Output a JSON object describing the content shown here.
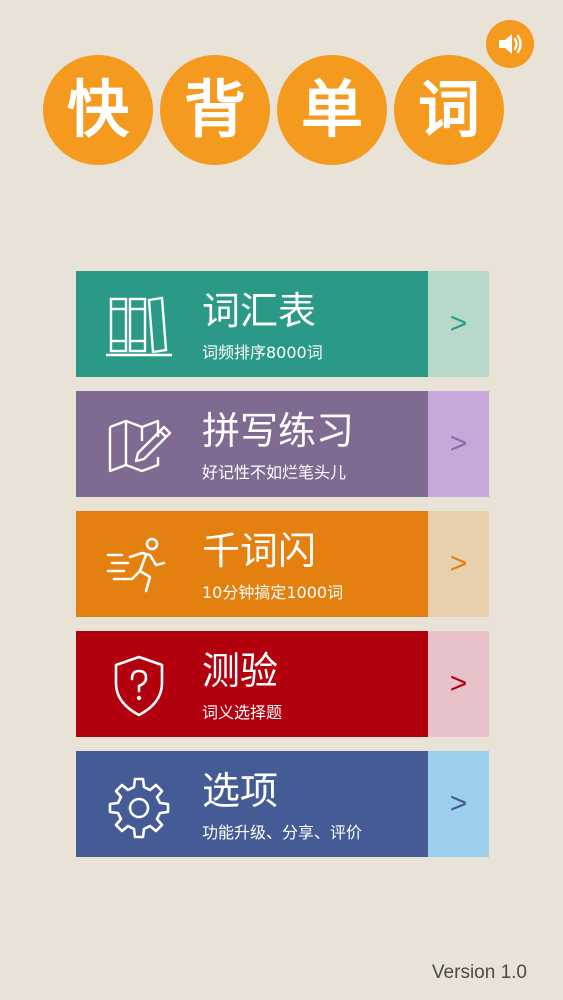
{
  "app": {
    "title_chars": [
      "快",
      "背",
      "单",
      "词"
    ],
    "sound_icon": "speaker-icon"
  },
  "menu": [
    {
      "title": "词汇表",
      "subtitle": "词频排序8000词",
      "arrow": ">",
      "icon": "books-icon",
      "main_color": "#2a9a87",
      "side_color": "#b7d9c9",
      "arrow_color": "#2a9a87"
    },
    {
      "title": "拼写练习",
      "subtitle": "好记性不如烂笔头儿",
      "arrow": ">",
      "icon": "map-pencil-icon",
      "main_color": "#7f6b91",
      "side_color": "#c6a8db",
      "arrow_color": "#8b6fa3"
    },
    {
      "title": "千词闪",
      "subtitle": "10分钟搞定1000词",
      "arrow": ">",
      "icon": "running-man-icon",
      "main_color": "#e4800f",
      "side_color": "#e8cfae",
      "arrow_color": "#e4800f"
    },
    {
      "title": "测验",
      "subtitle": "词义选择题",
      "arrow": ">",
      "icon": "shield-question-icon",
      "main_color": "#b3000f",
      "side_color": "#e7c3c9",
      "arrow_color": "#b3000f"
    },
    {
      "title": "选项",
      "subtitle": "功能升级、分享、评价",
      "arrow": ">",
      "icon": "gear-icon",
      "main_color": "#445b96",
      "side_color": "#9ccfec",
      "arrow_color": "#445b96"
    }
  ],
  "footer": {
    "version": "Version 1.0"
  }
}
